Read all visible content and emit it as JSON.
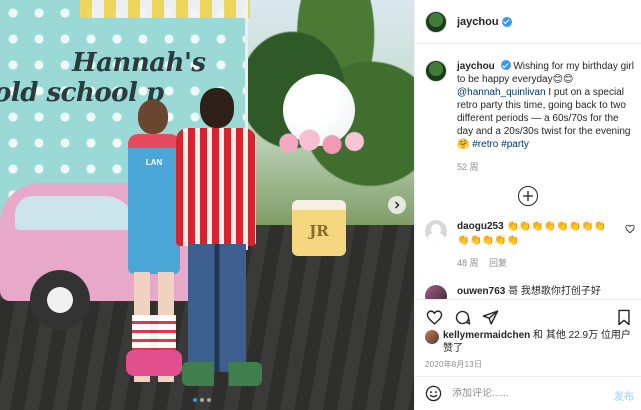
{
  "post": {
    "author": "jaychou",
    "verified": true,
    "caption": {
      "text_before": "Wishing for my birthday girl to be happy everyday😊😊",
      "mention": "@hannah_quinlivan",
      "text_after": " I put on a special retro party this time, going back to two different periods — a 60s/70s for the day and a 20s/30s twist for the evening🤗",
      "tag_retro": "#retro",
      "tag_party": "#party",
      "age": "52 周"
    },
    "image": {
      "banner_line1": "Hannah's",
      "banner_line2": "old school p",
      "dress_text": "LAN",
      "basket_text": "JR",
      "carousel_count": 3,
      "carousel_active": 0
    }
  },
  "comments": [
    {
      "user": "daogu253",
      "text": "👏👏👏👏👏👏👏👏👏👏👏👏👏",
      "age": "48 周",
      "reply": "回复"
    },
    {
      "user": "ouwen763",
      "text": "哥 我想歌你打创子好"
    }
  ],
  "likes": {
    "liker": "kellymermaidchen",
    "text": " 和 其他 22.9万 位用户赞了"
  },
  "date": "2020年8月13日",
  "add_comment": {
    "placeholder": "添加评论......",
    "post_label": "发布"
  },
  "colors": {
    "link": "#00376b",
    "verified": "#3897f0",
    "muted": "#8e8e8e",
    "post_button": "#b2dffc"
  }
}
